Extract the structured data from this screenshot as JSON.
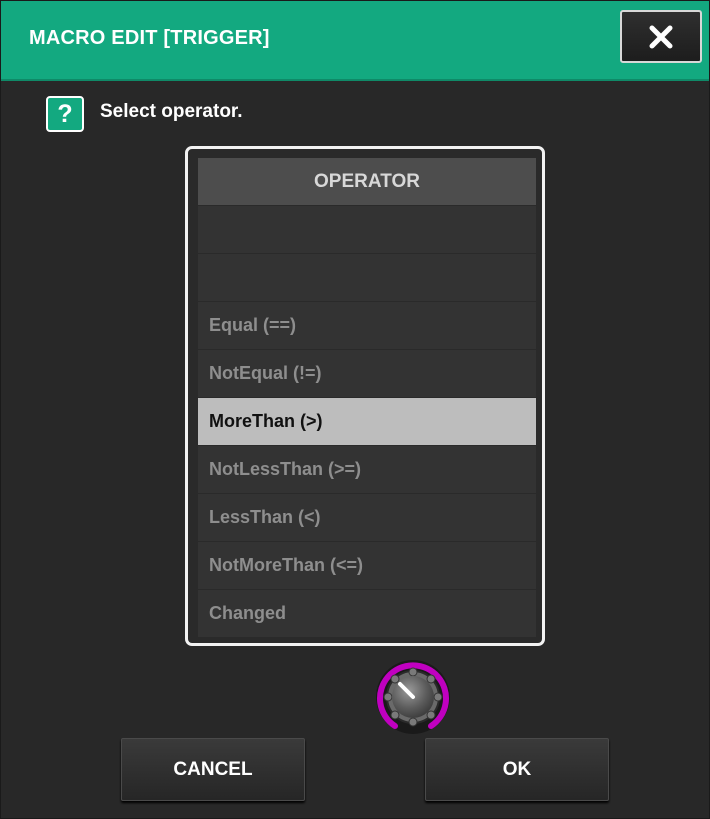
{
  "dialog": {
    "title": "MACRO EDIT [TRIGGER]",
    "prompt": "Select operator.",
    "help_icon_glyph": "?",
    "accent_color": "#13a980"
  },
  "operator_list": {
    "header": "OPERATOR",
    "items": [
      {
        "label": "",
        "selected": false
      },
      {
        "label": "",
        "selected": false
      },
      {
        "label": "Equal (==)",
        "selected": false
      },
      {
        "label": "NotEqual (!=)",
        "selected": false
      },
      {
        "label": "MoreThan (>)",
        "selected": true
      },
      {
        "label": "NotLessThan (>=)",
        "selected": false
      },
      {
        "label": "LessThan (<)",
        "selected": false
      },
      {
        "label": "NotMoreThan (<=)",
        "selected": false
      },
      {
        "label": "Changed",
        "selected": false
      }
    ]
  },
  "knob": {
    "icon": "rotary-knob-icon",
    "ring_color": "#c000c0"
  },
  "buttons": {
    "cancel": "CANCEL",
    "ok": "OK",
    "close_icon": "close-icon"
  }
}
